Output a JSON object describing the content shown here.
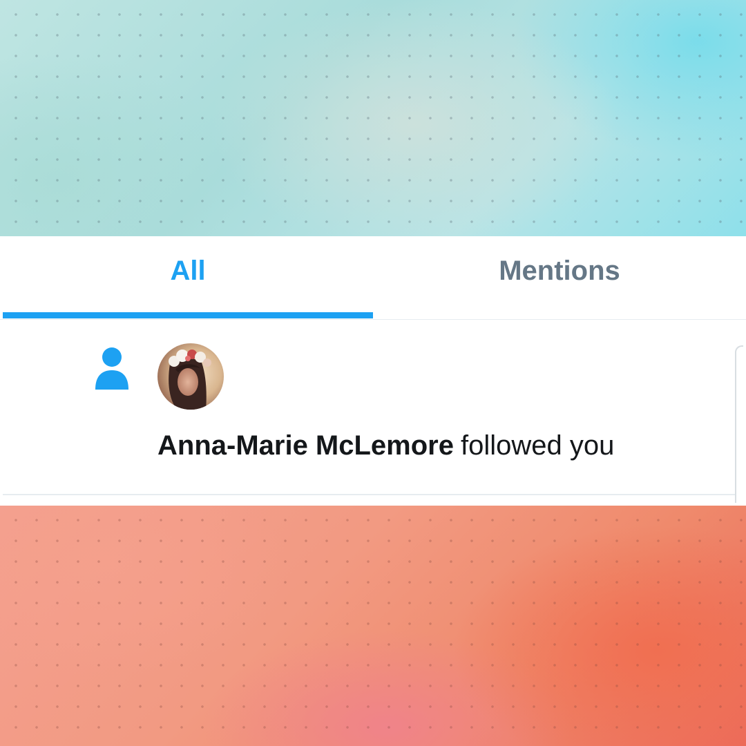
{
  "tabs": [
    {
      "label": "All",
      "active": true
    },
    {
      "label": "Mentions",
      "active": false
    }
  ],
  "notification": {
    "type_icon": "person-icon",
    "user_name": "Anna-Marie McLemore",
    "action_text": "followed you"
  },
  "colors": {
    "accent": "#1da1f2",
    "inactive_tab": "#657786",
    "text": "#14171a"
  }
}
